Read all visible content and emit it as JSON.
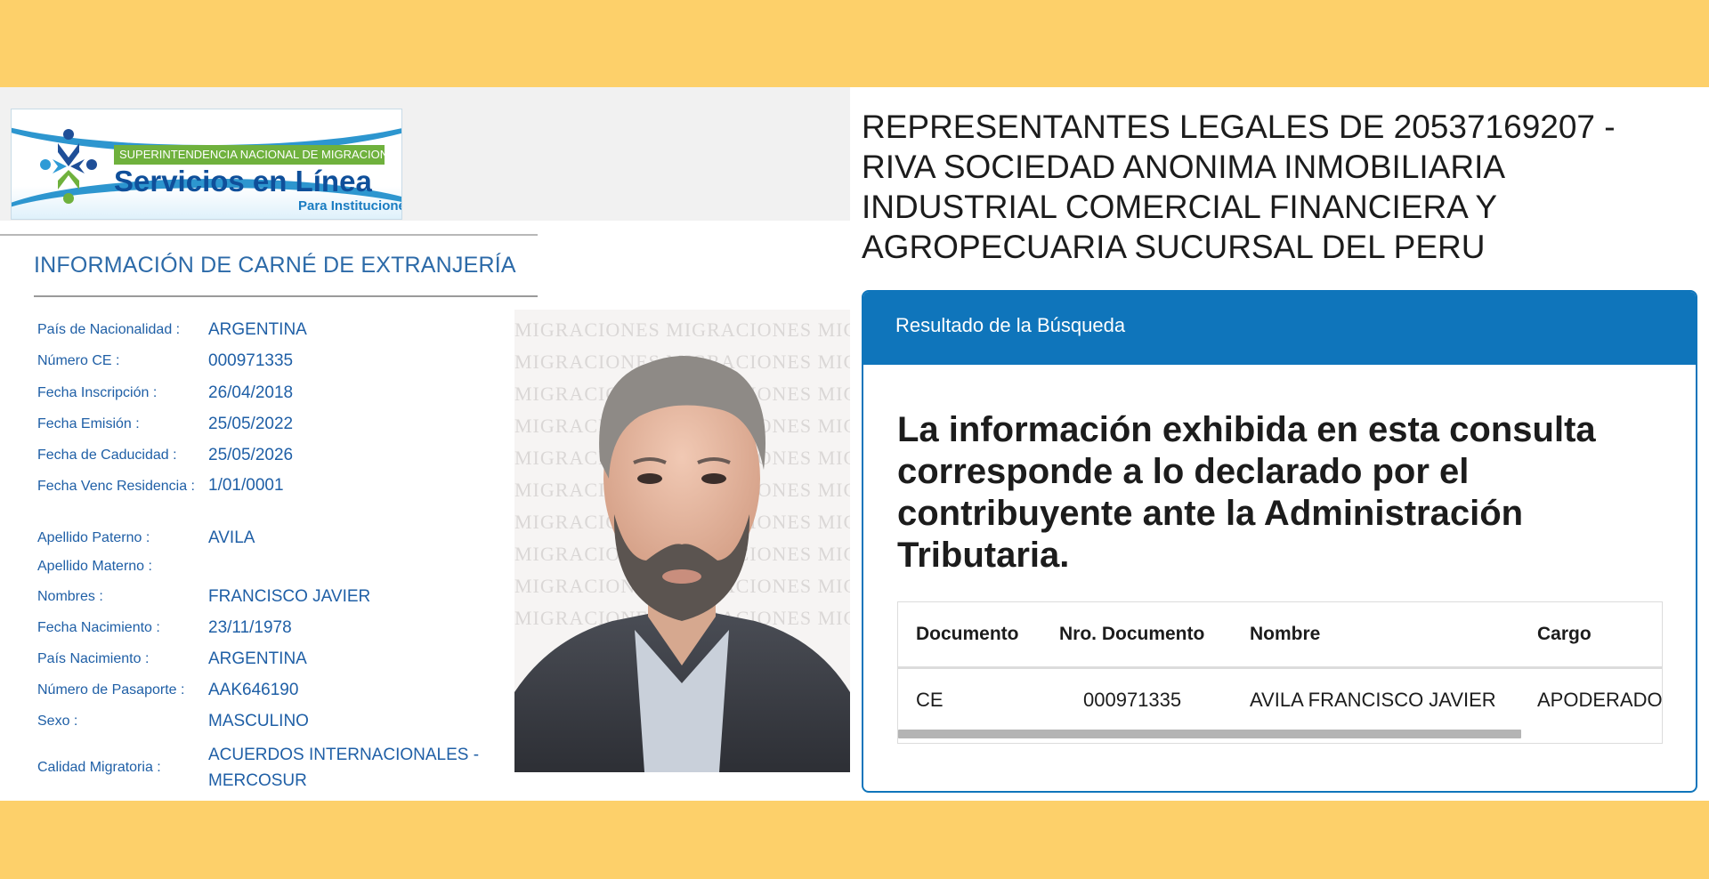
{
  "logo": {
    "banner": "SUPERINTENDENCIA NACIONAL DE MIGRACIONES",
    "title": "Servicios en Línea",
    "subtitle": "Para Instituciones"
  },
  "ce_info": {
    "section_title": "INFORMACIÓN DE CARNÉ DE EXTRANJERÍA",
    "rows": [
      {
        "label": "País de Nacionalidad :",
        "value": "ARGENTINA"
      },
      {
        "label": "Número CE :",
        "value": "000971335"
      },
      {
        "label": "Fecha Inscripción :",
        "value": "26/04/2018"
      },
      {
        "label": "Fecha Emisión :",
        "value": "25/05/2022"
      },
      {
        "label": "Fecha de Caducidad :",
        "value": "25/05/2026"
      },
      {
        "label": "Fecha Venc Residencia :",
        "value": "1/01/0001"
      },
      {
        "label": "Apellido Paterno :",
        "value": "AVILA"
      },
      {
        "label": "Apellido Materno :",
        "value": ""
      },
      {
        "label": "Nombres :",
        "value": "FRANCISCO JAVIER"
      },
      {
        "label": "Fecha Nacimiento :",
        "value": "23/11/1978"
      },
      {
        "label": "País Nacimiento :",
        "value": "ARGENTINA"
      },
      {
        "label": "Número de Pasaporte :",
        "value": "AAK646190"
      },
      {
        "label": "Sexo :",
        "value": "MASCULINO"
      },
      {
        "label": "Calidad Migratoria :",
        "value": "ACUERDOS INTERNACIONALES - MERCOSUR"
      }
    ],
    "watermark_text": "MIGRACIONES"
  },
  "legal_reps": {
    "title_lines": [
      "REPRESENTANTES LEGALES DE 20537169207 -",
      "RIVA SOCIEDAD ANONIMA INMOBILIARIA",
      "INDUSTRIAL COMERCIAL FINANCIERA Y",
      "AGROPECUARIA SUCURSAL DEL PERU"
    ],
    "card_header": "Resultado de la Búsqueda",
    "notice": "La información exhibida en esta consulta corresponde a lo declarado por el contribuyente ante la Administración Tributaria.",
    "table": {
      "columns": [
        "Documento",
        "Nro. Documento",
        "Nombre",
        "Cargo"
      ],
      "rows": [
        [
          "CE",
          "000971335",
          "AVILA FRANCISCO JAVIER",
          "APODERADO"
        ]
      ]
    }
  },
  "colors": {
    "background_band": "#fdd06a",
    "header_blue": "#0f75bb",
    "label_blue": "#1f5fa6"
  }
}
